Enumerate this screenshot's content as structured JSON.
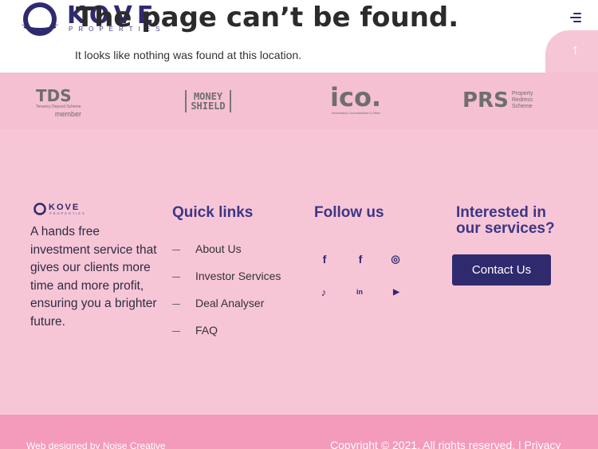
{
  "header": {
    "logo_text": "KOVE",
    "logo_sub": "PROPERTIES",
    "menu_icon": "menu-icon"
  },
  "error": {
    "title": "The page can’t be found.",
    "message": "It looks like nothing was found at this location."
  },
  "scroll_top_icon": "arrow-up-icon",
  "partners": {
    "tds": {
      "main": "TDS",
      "sub": "Tenancy Deposit Scheme",
      "member": "member"
    },
    "money_shield": {
      "line1": "MONEY",
      "line2": "SHIELD"
    },
    "ico": {
      "main": "ico.",
      "sub": "Information Commissioner's Office"
    },
    "prs": {
      "main": "PRS",
      "sub_line1": "Property",
      "sub_line2": "Redress",
      "sub_line3": "Scheme"
    }
  },
  "footer": {
    "logo_text": "KOVE",
    "logo_sub": "PROPERTIES",
    "tagline": "A hands free investment service that gives our clients more time and more profit, ensuring you a brighter future.",
    "quick_links_title": "Quick links",
    "quick_links": [
      {
        "label": "About Us"
      },
      {
        "label": "Investor Services"
      },
      {
        "label": "Deal Analyser"
      },
      {
        "label": "FAQ"
      }
    ],
    "follow_title": "Follow us",
    "social": [
      {
        "icon": "facebook-icon",
        "glyph": "f"
      },
      {
        "icon": "facebook-icon",
        "glyph": "f"
      },
      {
        "icon": "instagram-icon",
        "glyph": "◎"
      },
      {
        "icon": "tiktok-icon",
        "glyph": "♪"
      },
      {
        "icon": "linkedin-icon",
        "glyph": "in"
      },
      {
        "icon": "youtube-icon",
        "glyph": "▶"
      }
    ],
    "interested_title": "Interested in our services?",
    "contact_label": "Contact Us"
  },
  "bottom": {
    "credit": "Web designed by Noise Creative",
    "copyright": "Copyright © 2021. All rights reserved. | Privacy"
  },
  "colors": {
    "brand": "#2f2a6e",
    "footer_bg": "#f7c6d6",
    "bottom_bar": "#f49aba"
  }
}
